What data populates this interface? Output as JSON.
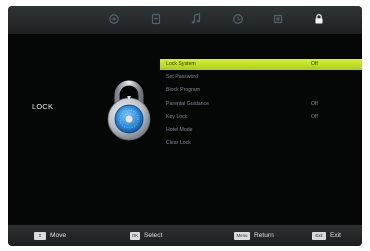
{
  "colors": {
    "screen_bg": "#070808",
    "topbar_bg": "#2b3033",
    "selected_bar": "#c4e12a",
    "menu_text": "#7f8a92",
    "tab_icon": "#56606a",
    "tab_icon_active": "#f2f2f2"
  },
  "tabs": [
    {
      "icon": "picture-icon",
      "active": false
    },
    {
      "icon": "sound-icon",
      "active": false
    },
    {
      "icon": "music-note-icon",
      "active": false
    },
    {
      "icon": "clock-icon",
      "active": false
    },
    {
      "icon": "settings-icon",
      "active": false
    },
    {
      "icon": "lock-icon",
      "active": true
    }
  ],
  "page": {
    "title": "LOCK"
  },
  "menu": {
    "items": [
      {
        "label": "Lock System",
        "value": "Off",
        "selected": true
      },
      {
        "label": "Set Password",
        "value": "",
        "selected": false
      },
      {
        "label": "Block Program",
        "value": "",
        "selected": false
      },
      {
        "label": "Parental Guidance",
        "value": "Off",
        "selected": false
      },
      {
        "label": "Key Lock",
        "value": "Off",
        "selected": false
      },
      {
        "label": "Hotel Mode",
        "value": "",
        "selected": false
      },
      {
        "label": "Clear Lock",
        "value": "",
        "selected": false
      }
    ]
  },
  "footer": {
    "move": {
      "key": "⇕",
      "label": "Move"
    },
    "select": {
      "key": "OK",
      "label": "Select"
    },
    "return": {
      "key": "Menu",
      "label": "Return"
    },
    "exit": {
      "key": "Exit",
      "label": "Exit"
    }
  }
}
